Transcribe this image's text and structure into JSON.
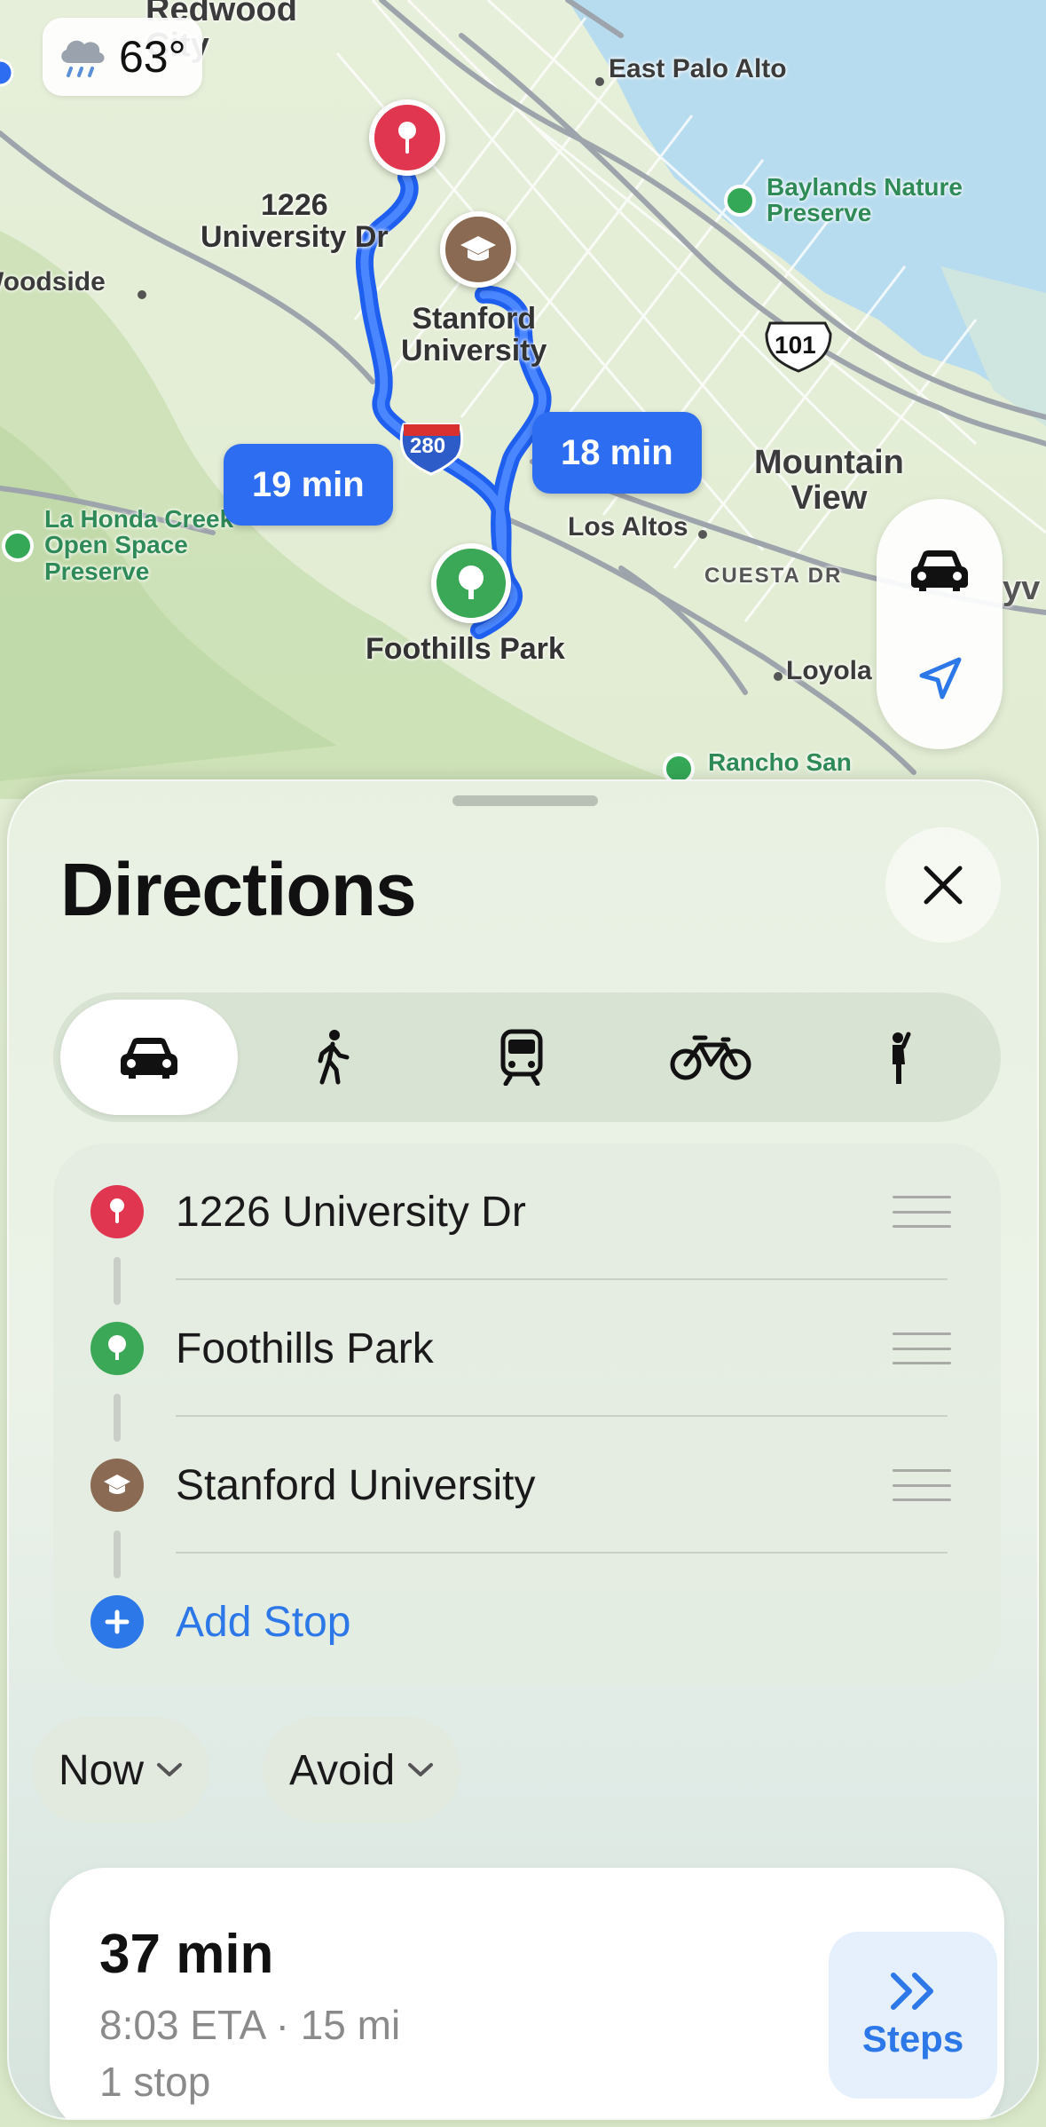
{
  "weather": {
    "temperature": "63°",
    "icon": "cloud-rain-icon"
  },
  "map": {
    "places": {
      "redwood_city": "Redwood\nCity",
      "east_palo_alto": "East Palo Alto",
      "baylands": "Baylands Nature\nPreserve",
      "woodside": "Woodside",
      "mountain_view": "Mountain\nView",
      "la_honda": "La Honda Creek\nOpen Space\nPreserve",
      "los_altos": "Los Altos",
      "cuesta_dr": "CUESTA DR",
      "loyola": "Loyola",
      "rancho_san": "Rancho San",
      "highway_101": "101",
      "highway_280": "280",
      "partial_edge": "yv"
    },
    "pins": {
      "start": "1226\nUniversity Dr",
      "stanford": "Stanford\nUniversity",
      "foothills": "Foothills Park"
    },
    "eta_bubbles": {
      "left": "19 min",
      "right": "18 min"
    }
  },
  "sheet": {
    "title": "Directions",
    "modes": [
      {
        "name": "drive",
        "icon": "car-icon",
        "active": true
      },
      {
        "name": "walk",
        "icon": "walking-icon",
        "active": false
      },
      {
        "name": "transit",
        "icon": "train-icon",
        "active": false
      },
      {
        "name": "cycle",
        "icon": "bicycle-icon",
        "active": false
      },
      {
        "name": "rideshare",
        "icon": "person-hailing-icon",
        "active": false
      }
    ],
    "stops": [
      {
        "label": "1226 University Dr",
        "icon": "map-pin-icon",
        "color": "#e0364f"
      },
      {
        "label": "Foothills Park",
        "icon": "tree-icon",
        "color": "#3aa856"
      },
      {
        "label": "Stanford University",
        "icon": "graduation-cap-icon",
        "color": "#8a6a52"
      }
    ],
    "add_stop": "Add Stop",
    "options": {
      "time": "Now",
      "avoid": "Avoid"
    },
    "route": {
      "duration": "37 min",
      "details": "8:03 ETA · 15 mi",
      "stops": "1 stop",
      "steps_label": "Steps"
    }
  },
  "colors": {
    "accent": "#2d78e8",
    "route": "#2d6df2",
    "start_pin": "#e0364f",
    "park": "#3aa856",
    "university": "#8a6a52"
  }
}
